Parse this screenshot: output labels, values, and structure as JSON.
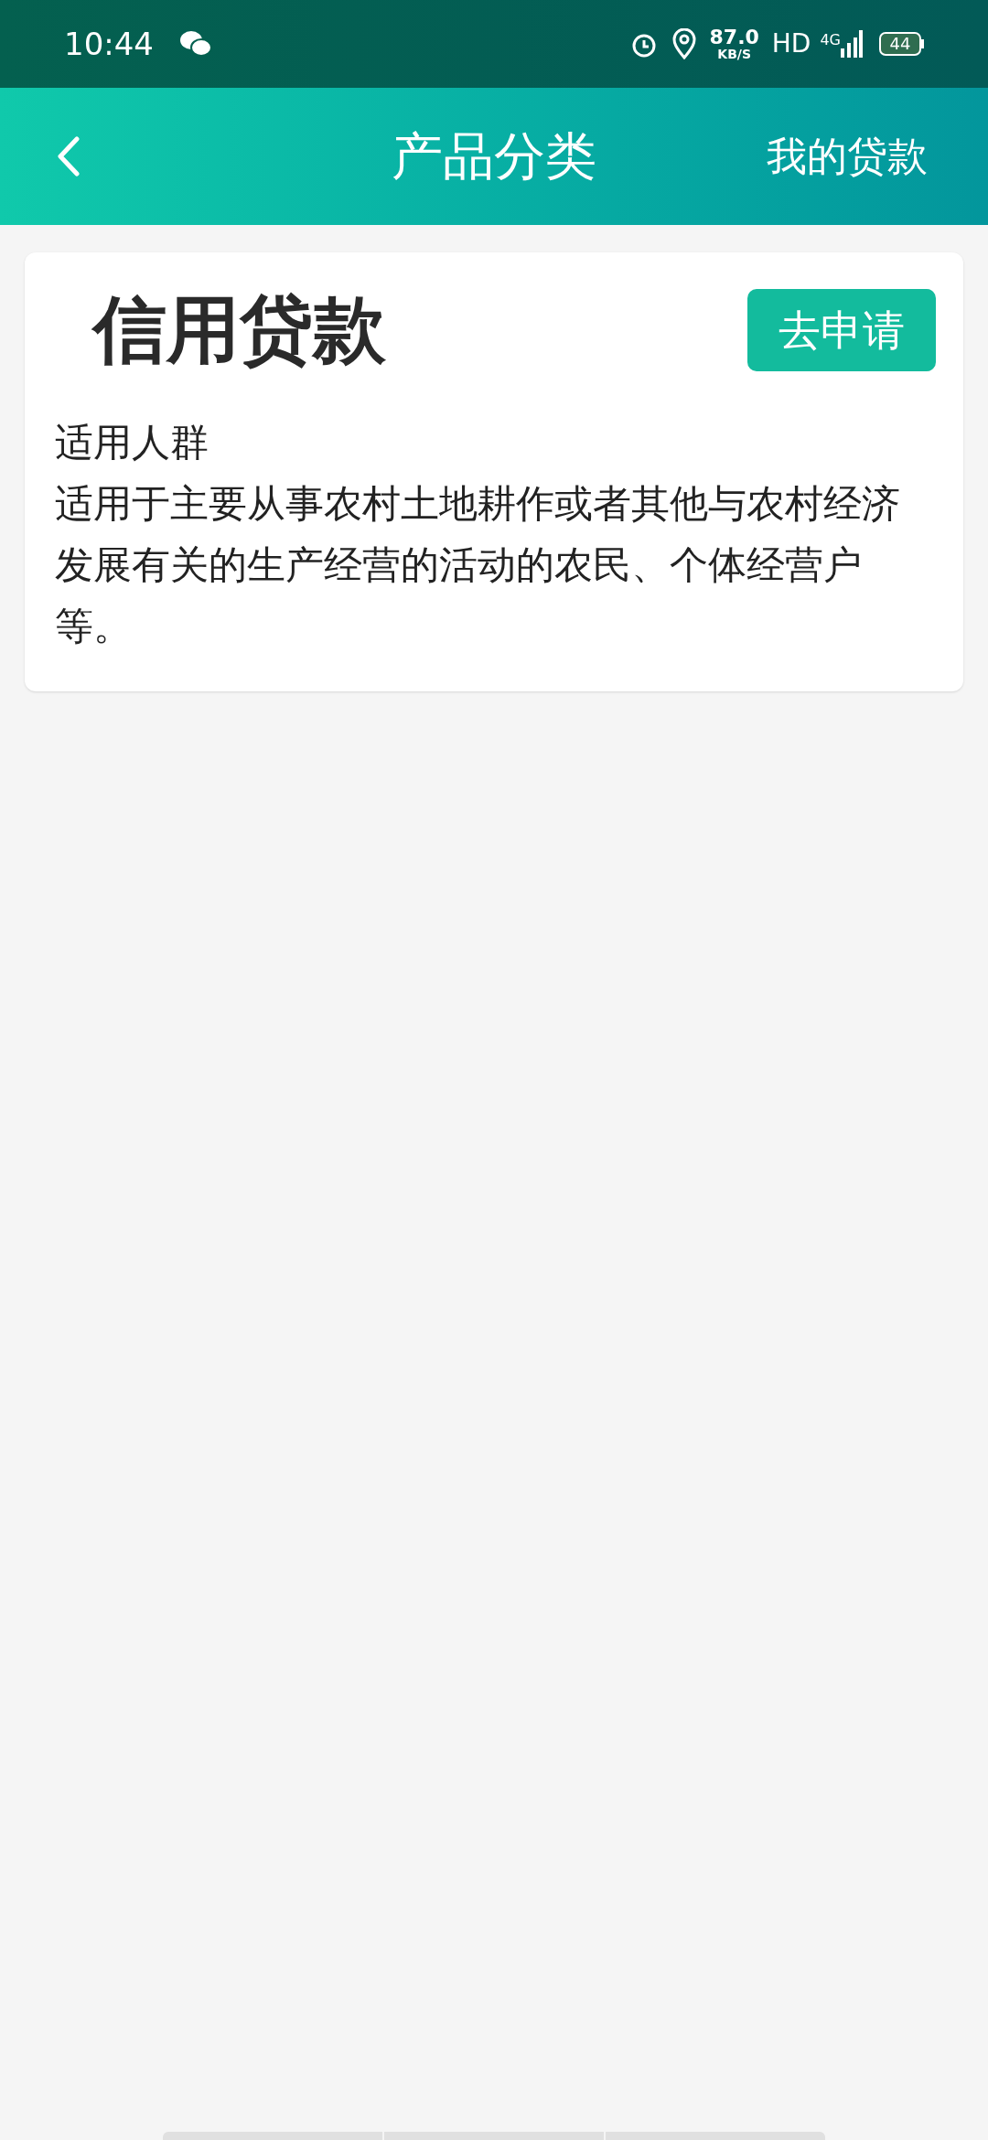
{
  "status_bar": {
    "time": "10:44",
    "speed": "87.0",
    "speed_unit": "KB/S",
    "hd": "HD",
    "network": "4G",
    "battery": "44"
  },
  "header": {
    "title": "产品分类",
    "action": "我的贷款"
  },
  "card": {
    "title": "信用贷款",
    "button": "去申请",
    "label": "适用人群",
    "description": "适用于主要从事农村土地耕作或者其他与农村经济发展有关的生产经营的活动的农民、个体经营户等。"
  }
}
